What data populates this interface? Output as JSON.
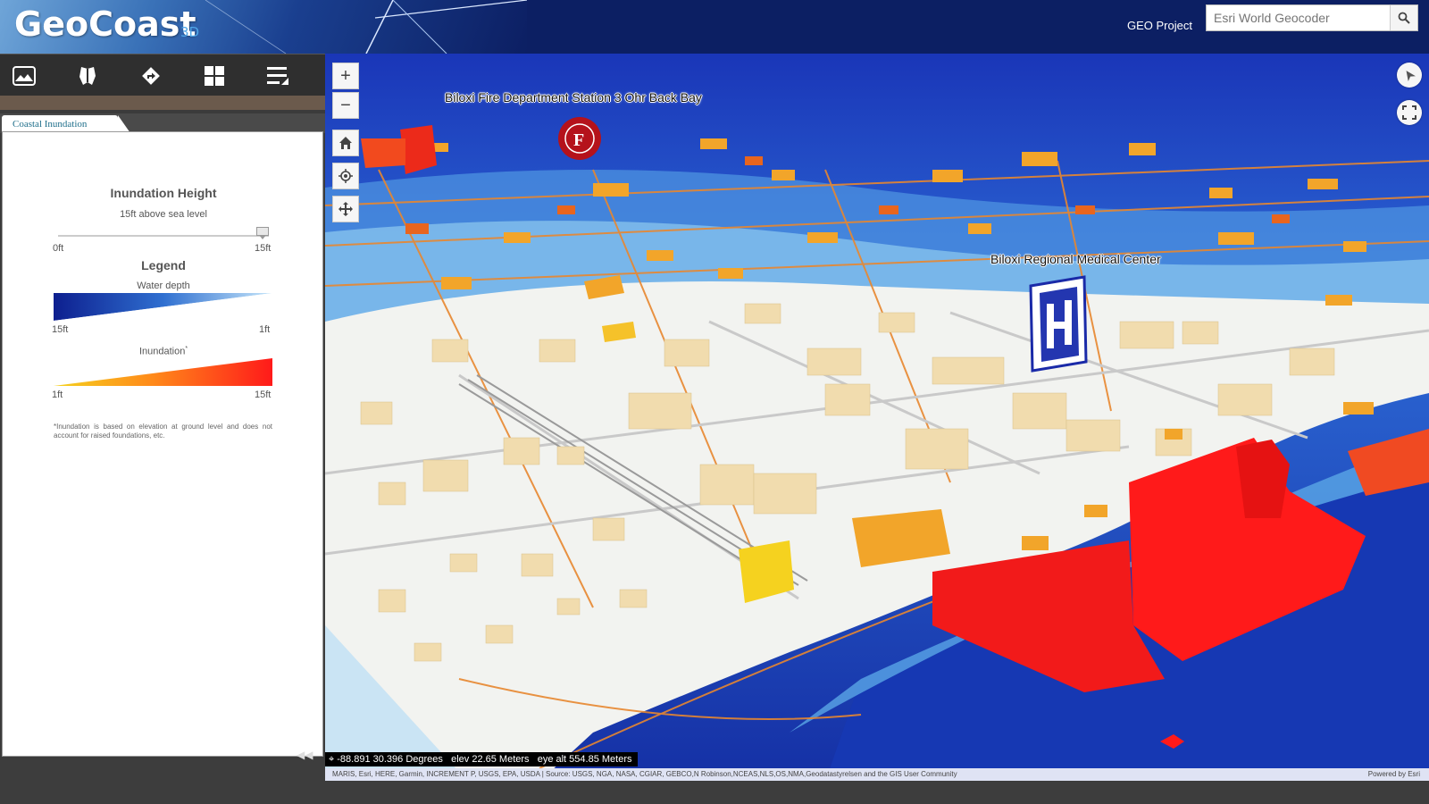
{
  "header": {
    "app_title": "GeoCoast",
    "app_subtitle": "3D",
    "project_label": "GEO Project",
    "search_placeholder": "Esri World Geocoder"
  },
  "toolbar": {
    "items": [
      {
        "icon": "basemap-icon"
      },
      {
        "icon": "map-shape-icon"
      },
      {
        "icon": "directions-icon"
      },
      {
        "icon": "grid-icon"
      },
      {
        "icon": "layer-list-icon"
      }
    ]
  },
  "panel": {
    "tab_label": "Coastal Inundation",
    "section_title": "Inundation Height",
    "slider_value_text": "15ft above sea level",
    "slider_min": "0ft",
    "slider_max": "15ft",
    "slider_value_fraction": 1.0,
    "legend_title": "Legend",
    "water_depth_label": "Water depth",
    "water_depth_min": "15ft",
    "water_depth_max": "1ft",
    "inundation_label": "Inundation",
    "inundation_mark": "*",
    "inundation_min": "1ft",
    "inundation_max": "15ft",
    "footnote": "*Inundation is based on elevation at ground level and does not account for raised foundations, etc."
  },
  "map": {
    "labels": {
      "fire_station": "Biloxi Fire Department Station 3 Ohr Back Bay",
      "hospital": "Biloxi Regional Medical Center"
    },
    "coordinates_text": "-88.891 30.396 Degrees",
    "elevation_text": "elev 22.65 Meters",
    "eye_alt_text": "eye alt 554.85 Meters",
    "attribution": "MARIS, Esri, HERE, Garmin, INCREMENT P, USGS, EPA, USDA | Source: USGS, NGA, NASA, CGIAR, GEBCO,N Robinson,NCEAS,NLS,OS,NMA,Geodatastyrelsen and the GIS User Community",
    "powered_by": "Powered by Esri"
  },
  "colors": {
    "header_bg": "#0c1f63",
    "water_deep": "#0d1f8f",
    "water_shallow": "#7fc3ee",
    "inundation_low": "#f5d21f",
    "inundation_high": "#ff1a1a",
    "building": "#f1dcae"
  }
}
